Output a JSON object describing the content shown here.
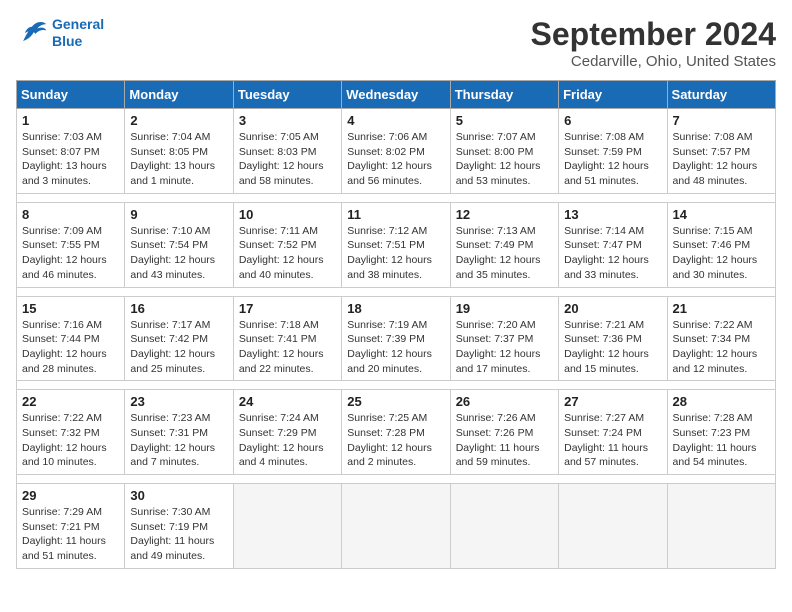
{
  "header": {
    "logo_line1": "General",
    "logo_line2": "Blue",
    "title": "September 2024",
    "subtitle": "Cedarville, Ohio, United States"
  },
  "calendar": {
    "days_of_week": [
      "Sunday",
      "Monday",
      "Tuesday",
      "Wednesday",
      "Thursday",
      "Friday",
      "Saturday"
    ],
    "weeks": [
      [
        {
          "day": "1",
          "sunrise": "7:03 AM",
          "sunset": "8:07 PM",
          "daylight": "13 hours and 3 minutes."
        },
        {
          "day": "2",
          "sunrise": "7:04 AM",
          "sunset": "8:05 PM",
          "daylight": "13 hours and 1 minute."
        },
        {
          "day": "3",
          "sunrise": "7:05 AM",
          "sunset": "8:03 PM",
          "daylight": "12 hours and 58 minutes."
        },
        {
          "day": "4",
          "sunrise": "7:06 AM",
          "sunset": "8:02 PM",
          "daylight": "12 hours and 56 minutes."
        },
        {
          "day": "5",
          "sunrise": "7:07 AM",
          "sunset": "8:00 PM",
          "daylight": "12 hours and 53 minutes."
        },
        {
          "day": "6",
          "sunrise": "7:08 AM",
          "sunset": "7:59 PM",
          "daylight": "12 hours and 51 minutes."
        },
        {
          "day": "7",
          "sunrise": "7:08 AM",
          "sunset": "7:57 PM",
          "daylight": "12 hours and 48 minutes."
        }
      ],
      [
        {
          "day": "8",
          "sunrise": "7:09 AM",
          "sunset": "7:55 PM",
          "daylight": "12 hours and 46 minutes."
        },
        {
          "day": "9",
          "sunrise": "7:10 AM",
          "sunset": "7:54 PM",
          "daylight": "12 hours and 43 minutes."
        },
        {
          "day": "10",
          "sunrise": "7:11 AM",
          "sunset": "7:52 PM",
          "daylight": "12 hours and 40 minutes."
        },
        {
          "day": "11",
          "sunrise": "7:12 AM",
          "sunset": "7:51 PM",
          "daylight": "12 hours and 38 minutes."
        },
        {
          "day": "12",
          "sunrise": "7:13 AM",
          "sunset": "7:49 PM",
          "daylight": "12 hours and 35 minutes."
        },
        {
          "day": "13",
          "sunrise": "7:14 AM",
          "sunset": "7:47 PM",
          "daylight": "12 hours and 33 minutes."
        },
        {
          "day": "14",
          "sunrise": "7:15 AM",
          "sunset": "7:46 PM",
          "daylight": "12 hours and 30 minutes."
        }
      ],
      [
        {
          "day": "15",
          "sunrise": "7:16 AM",
          "sunset": "7:44 PM",
          "daylight": "12 hours and 28 minutes."
        },
        {
          "day": "16",
          "sunrise": "7:17 AM",
          "sunset": "7:42 PM",
          "daylight": "12 hours and 25 minutes."
        },
        {
          "day": "17",
          "sunrise": "7:18 AM",
          "sunset": "7:41 PM",
          "daylight": "12 hours and 22 minutes."
        },
        {
          "day": "18",
          "sunrise": "7:19 AM",
          "sunset": "7:39 PM",
          "daylight": "12 hours and 20 minutes."
        },
        {
          "day": "19",
          "sunrise": "7:20 AM",
          "sunset": "7:37 PM",
          "daylight": "12 hours and 17 minutes."
        },
        {
          "day": "20",
          "sunrise": "7:21 AM",
          "sunset": "7:36 PM",
          "daylight": "12 hours and 15 minutes."
        },
        {
          "day": "21",
          "sunrise": "7:22 AM",
          "sunset": "7:34 PM",
          "daylight": "12 hours and 12 minutes."
        }
      ],
      [
        {
          "day": "22",
          "sunrise": "7:22 AM",
          "sunset": "7:32 PM",
          "daylight": "12 hours and 10 minutes."
        },
        {
          "day": "23",
          "sunrise": "7:23 AM",
          "sunset": "7:31 PM",
          "daylight": "12 hours and 7 minutes."
        },
        {
          "day": "24",
          "sunrise": "7:24 AM",
          "sunset": "7:29 PM",
          "daylight": "12 hours and 4 minutes."
        },
        {
          "day": "25",
          "sunrise": "7:25 AM",
          "sunset": "7:28 PM",
          "daylight": "12 hours and 2 minutes."
        },
        {
          "day": "26",
          "sunrise": "7:26 AM",
          "sunset": "7:26 PM",
          "daylight": "11 hours and 59 minutes."
        },
        {
          "day": "27",
          "sunrise": "7:27 AM",
          "sunset": "7:24 PM",
          "daylight": "11 hours and 57 minutes."
        },
        {
          "day": "28",
          "sunrise": "7:28 AM",
          "sunset": "7:23 PM",
          "daylight": "11 hours and 54 minutes."
        }
      ],
      [
        {
          "day": "29",
          "sunrise": "7:29 AM",
          "sunset": "7:21 PM",
          "daylight": "11 hours and 51 minutes."
        },
        {
          "day": "30",
          "sunrise": "7:30 AM",
          "sunset": "7:19 PM",
          "daylight": "11 hours and 49 minutes."
        },
        null,
        null,
        null,
        null,
        null
      ]
    ]
  }
}
